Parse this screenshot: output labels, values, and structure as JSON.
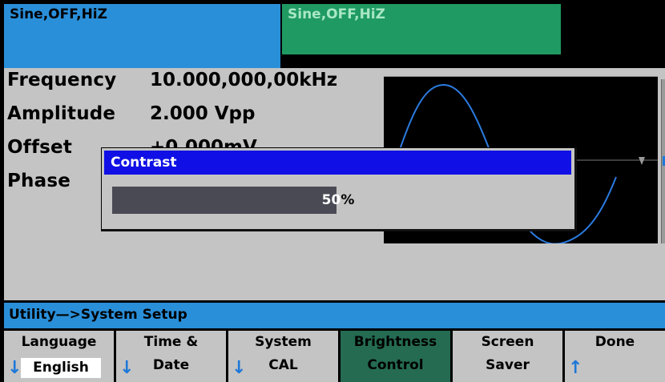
{
  "tabs": [
    {
      "label": "Sine,OFF,HiZ",
      "color": "#2a8fd9"
    },
    {
      "label": "Sine,OFF,HiZ",
      "color": "#1f9a62"
    }
  ],
  "params": [
    {
      "label": "Frequency",
      "value": "10.000,000,00kHz"
    },
    {
      "label": "Amplitude",
      "value": "2.000 Vpp"
    },
    {
      "label": "Offset",
      "value": "+0.000mV"
    },
    {
      "label": "Phase",
      "value": ""
    }
  ],
  "dialog": {
    "title": "Contrast",
    "value_text": "50",
    "unit": "%",
    "level_fraction": 0.5,
    "title_color": "#1010e6"
  },
  "breadcrumb": "Utility—>System Setup",
  "softkeys": [
    {
      "line1": "Language",
      "line2": "English",
      "arrow": "down",
      "active": false
    },
    {
      "line1": "Time &",
      "line2": "Date",
      "arrow": "down",
      "active": false
    },
    {
      "line1": "System",
      "line2": "CAL",
      "arrow": "down",
      "active": false
    },
    {
      "line1": "Brightness",
      "line2": "Control",
      "arrow": "",
      "active": true
    },
    {
      "line1": "Screen",
      "line2": "Saver",
      "arrow": "",
      "active": false
    },
    {
      "line1": "Done",
      "line2": "",
      "arrow": "up",
      "active": false
    }
  ],
  "icons": {
    "down": "arrow-down-icon",
    "up": "arrow-up-icon"
  },
  "colors": {
    "accent_blue": "#2a8fd9",
    "active_key": "#246b52",
    "panel_gray": "#c4c4c4"
  }
}
